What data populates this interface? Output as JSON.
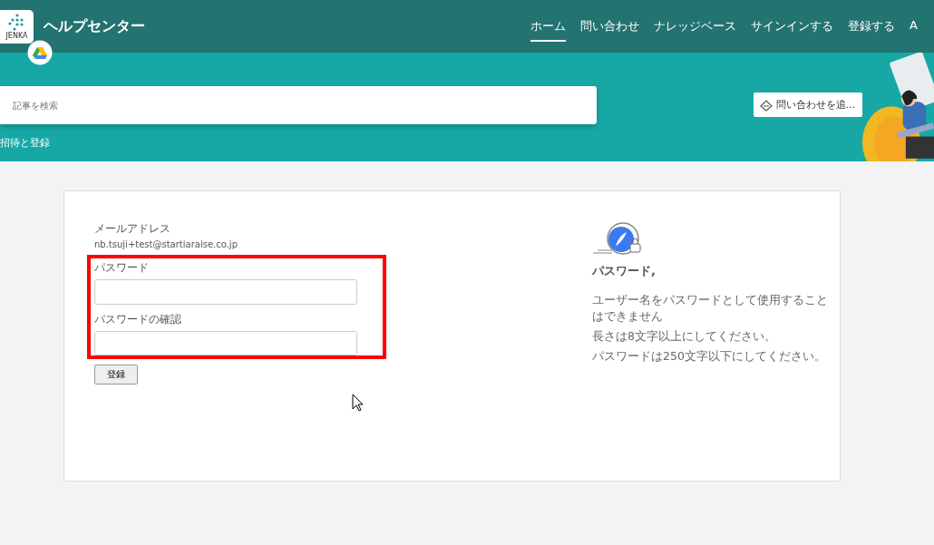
{
  "header": {
    "logo_text": "JENKA",
    "title": "ヘルプセンター",
    "nav": [
      {
        "label": "ホーム",
        "selected": true
      },
      {
        "label": "問い合わせ",
        "selected": false
      },
      {
        "label": "ナレッジベース",
        "selected": false
      },
      {
        "label": "サインインする",
        "selected": false
      },
      {
        "label": "登録する",
        "selected": false
      },
      {
        "label": "A",
        "selected": false
      }
    ]
  },
  "hero": {
    "search": {
      "placeholder": "記事を検索"
    },
    "breadcrumb": "招待と登録",
    "contact_button": "問い合わせを追..."
  },
  "form": {
    "email_label": "メールアドレス",
    "email_value": "nb.tsuji+test@startiaraise.co.jp",
    "password_label": "パスワード",
    "confirm_label": "パスワードの確認",
    "submit": "登録"
  },
  "rules": {
    "title": "パスワード,",
    "items": [
      "ユーザー名をパスワードとして使用することはできません",
      "長さは8文字以上にしてください。",
      "パスワードは250文字以下にしてください。"
    ]
  }
}
